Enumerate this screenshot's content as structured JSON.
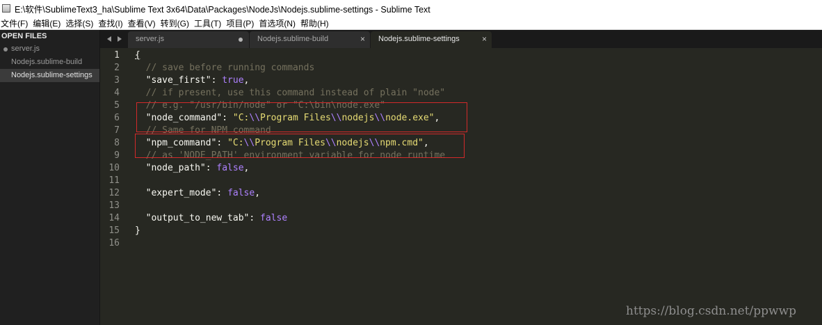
{
  "window": {
    "title": "E:\\软件\\SublimeText3_ha\\Sublime Text 3x64\\Data\\Packages\\NodeJs\\Nodejs.sublime-settings - Sublime Text",
    "icon": "sublime-app-icon"
  },
  "menu": {
    "items": [
      "文件(F)",
      "编辑(E)",
      "选择(S)",
      "查找(I)",
      "查看(V)",
      "转到(G)",
      "工具(T)",
      "项目(P)",
      "首选项(N)",
      "帮助(H)"
    ]
  },
  "sidebar": {
    "header": "OPEN FILES",
    "files": [
      {
        "label": "server.js",
        "dirty": true,
        "active": false
      },
      {
        "label": "Nodejs.sublime-build",
        "dirty": false,
        "active": false
      },
      {
        "label": "Nodejs.sublime-settings",
        "dirty": false,
        "active": true
      }
    ]
  },
  "tabs": [
    {
      "label": "server.js",
      "state": "dirty"
    },
    {
      "label": "Nodejs.sublime-build",
      "close": "×"
    },
    {
      "label": "Nodejs.sublime-settings",
      "close": "×",
      "active": true
    }
  ],
  "editor": {
    "current_line": 1,
    "lines": [
      [
        [
          "plain-cursor",
          "{"
        ]
      ],
      [
        [
          "plain",
          "  "
        ],
        [
          "comment",
          "// save before running commands"
        ]
      ],
      [
        [
          "plain",
          "  "
        ],
        [
          "key",
          "\"save_first\""
        ],
        [
          "plain",
          ": "
        ],
        [
          "const",
          "true"
        ],
        [
          "plain",
          ","
        ]
      ],
      [
        [
          "plain",
          "  "
        ],
        [
          "comment",
          "// if present, use this command instead of plain \"node\""
        ]
      ],
      [
        [
          "plain",
          "  "
        ],
        [
          "comment",
          "// e.g. \"/usr/bin/node\" or \"C:\\bin\\node.exe\""
        ]
      ],
      [
        [
          "plain",
          "  "
        ],
        [
          "key",
          "\"node_command\""
        ],
        [
          "plain",
          ": "
        ],
        [
          "string",
          "\"C:"
        ],
        [
          "escape",
          "\\\\"
        ],
        [
          "string",
          "Program Files"
        ],
        [
          "escape",
          "\\\\"
        ],
        [
          "string",
          "nodejs"
        ],
        [
          "escape",
          "\\\\"
        ],
        [
          "string",
          "node.exe\""
        ],
        [
          "plain",
          ","
        ]
      ],
      [
        [
          "plain",
          "  "
        ],
        [
          "comment",
          "// Same for NPM command"
        ]
      ],
      [
        [
          "plain",
          "  "
        ],
        [
          "key",
          "\"npm_command\""
        ],
        [
          "plain",
          ": "
        ],
        [
          "string",
          "\"C:"
        ],
        [
          "escape",
          "\\\\"
        ],
        [
          "string",
          "Program Files"
        ],
        [
          "escape",
          "\\\\"
        ],
        [
          "string",
          "nodejs"
        ],
        [
          "escape",
          "\\\\"
        ],
        [
          "string",
          "npm.cmd\""
        ],
        [
          "plain",
          ","
        ]
      ],
      [
        [
          "plain",
          "  "
        ],
        [
          "comment",
          "// as 'NODE_PATH' environment variable for node runtime"
        ]
      ],
      [
        [
          "plain",
          "  "
        ],
        [
          "key",
          "\"node_path\""
        ],
        [
          "plain",
          ": "
        ],
        [
          "const",
          "false"
        ],
        [
          "plain",
          ","
        ]
      ],
      [],
      [
        [
          "plain",
          "  "
        ],
        [
          "key",
          "\"expert_mode\""
        ],
        [
          "plain",
          ": "
        ],
        [
          "const",
          "false"
        ],
        [
          "plain",
          ","
        ]
      ],
      [],
      [
        [
          "plain",
          "  "
        ],
        [
          "key",
          "\"output_to_new_tab\""
        ],
        [
          "plain",
          ": "
        ],
        [
          "const",
          "false"
        ]
      ],
      [
        [
          "plain",
          "}"
        ]
      ],
      []
    ]
  },
  "colors": {
    "background": "#272822",
    "comment": "#75715e",
    "string": "#e6db74",
    "constant": "#ae81ff",
    "highlight_box": "#d32a2a"
  },
  "watermark": "https://blog.csdn.net/ppwwp"
}
